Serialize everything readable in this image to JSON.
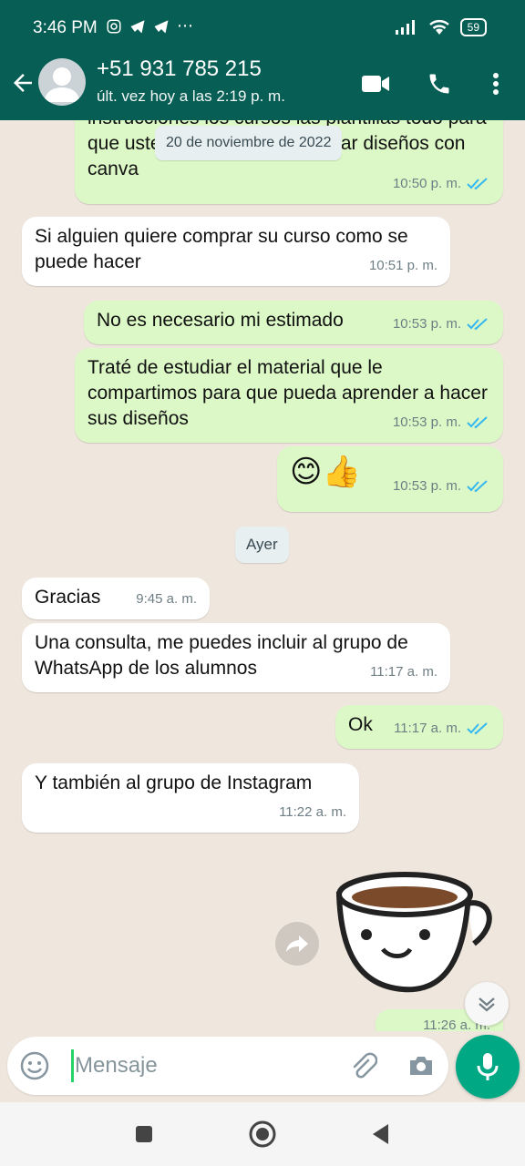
{
  "status_bar": {
    "time": "3:46 PM",
    "battery": "59"
  },
  "header": {
    "contact": "+51 931 785 215",
    "last_seen": "últ. vez hoy a las 2:19 p. m."
  },
  "chat": {
    "date_chip": "20 de noviembre de 2022",
    "partial_top": {
      "text": "instrucciones los cursos las plantillas todo para que usted ya puede pesar crear diseños con canva",
      "time": "10:50 p. m."
    },
    "messages": [
      {
        "text": "Si alguien quiere comprar su curso como se puede hacer",
        "time": "10:51 p. m."
      },
      {
        "text": "No es necesario mi estimado",
        "time": "10:53 p. m."
      },
      {
        "text": "Traté de estudiar el material que le compartimos para que pueda aprender a hacer sus diseños",
        "time": "10:53 p. m."
      },
      {
        "text": "😊👍",
        "time": "10:53 p. m."
      },
      {
        "text": "Gracias",
        "time": "9:45 a. m."
      },
      {
        "text": "Una consulta, me puedes incluir al grupo de WhatsApp de los alumnos",
        "time": "11:17 a. m."
      },
      {
        "text": "Ok",
        "time": "11:17 a. m."
      },
      {
        "text": "Y también al grupo de Instagram",
        "time": "11:22 a. m."
      }
    ],
    "ayer_chip": "Ayer",
    "partial_bottom_time": "11:26 a. m."
  },
  "input": {
    "placeholder": "Mensaje"
  },
  "colors": {
    "header": "#075e54",
    "outgoing": "#dcf8c6",
    "incoming": "#ffffff",
    "accent": "#00a884",
    "tick": "#34b7f1"
  },
  "icons": [
    "back-arrow-icon",
    "avatar-icon",
    "video-call-icon",
    "phone-icon",
    "more-vert-icon",
    "emoji-icon",
    "attach-icon",
    "camera-icon",
    "mic-icon",
    "forward-icon",
    "scroll-down-icon",
    "nav-square-icon",
    "nav-circle-icon",
    "nav-back-icon"
  ]
}
